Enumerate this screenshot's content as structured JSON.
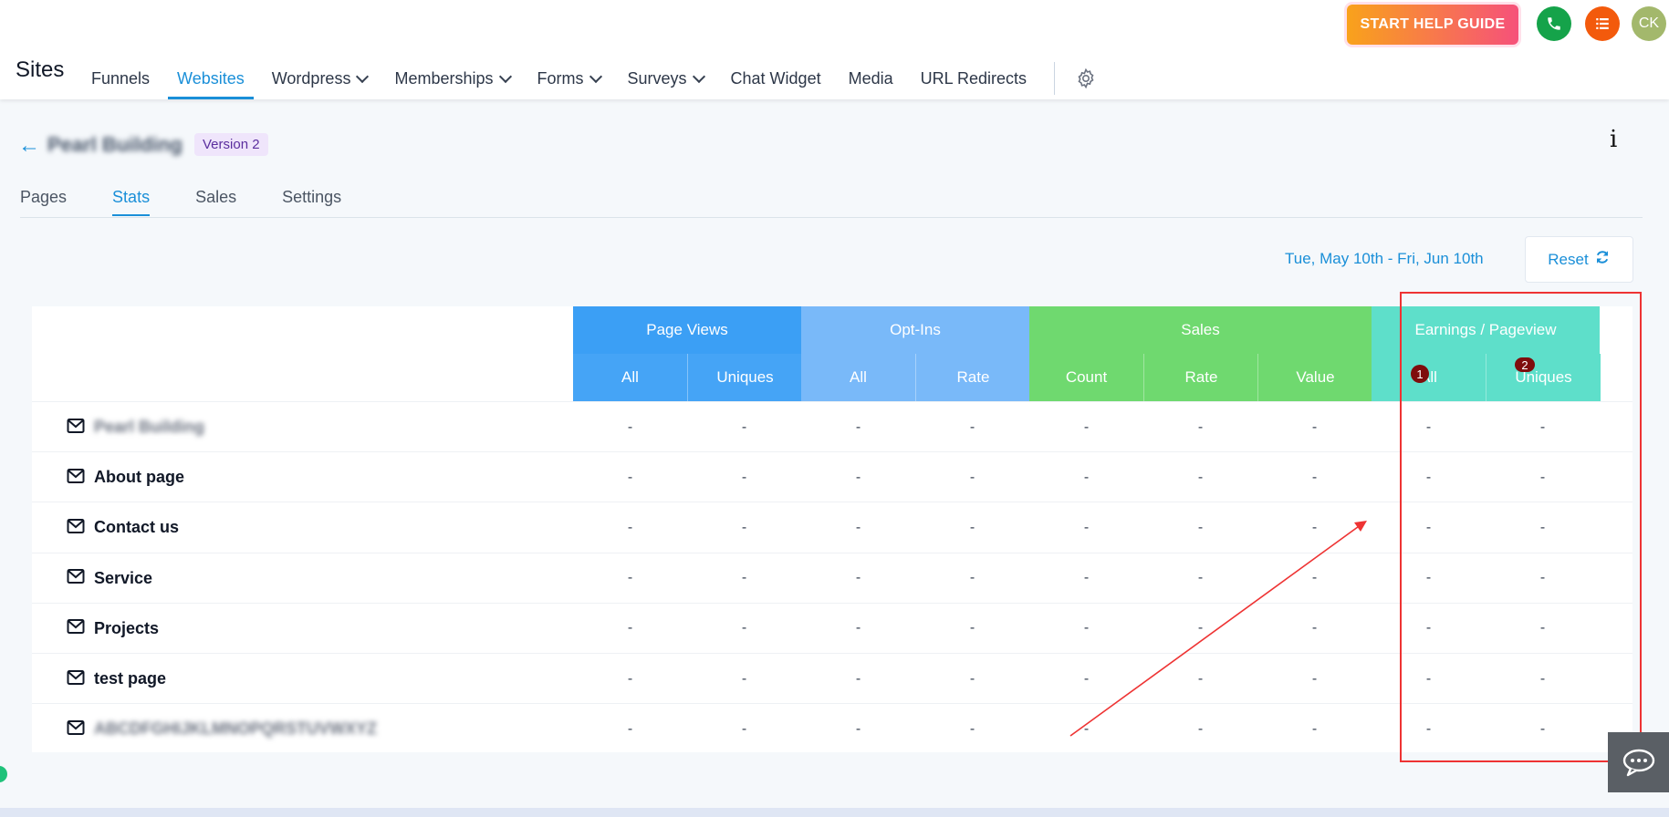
{
  "topbar": {
    "brand": "Sites",
    "nav": [
      {
        "label": "Funnels",
        "dropdown": false,
        "active": false
      },
      {
        "label": "Websites",
        "dropdown": false,
        "active": true
      },
      {
        "label": "Wordpress",
        "dropdown": true,
        "active": false
      },
      {
        "label": "Memberships",
        "dropdown": true,
        "active": false
      },
      {
        "label": "Forms",
        "dropdown": true,
        "active": false
      },
      {
        "label": "Surveys",
        "dropdown": true,
        "active": false
      },
      {
        "label": "Chat Widget",
        "dropdown": false,
        "active": false
      },
      {
        "label": "Media",
        "dropdown": false,
        "active": false
      },
      {
        "label": "URL Redirects",
        "dropdown": false,
        "active": false
      }
    ],
    "help_button": "START HELP GUIDE",
    "avatar_initials": "CK"
  },
  "header": {
    "site_name": "Pearl Building",
    "version": "Version 2",
    "info_symbol": "i"
  },
  "subtabs": [
    {
      "label": "Pages",
      "active": false
    },
    {
      "label": "Stats",
      "active": true
    },
    {
      "label": "Sales",
      "active": false
    },
    {
      "label": "Settings",
      "active": false
    }
  ],
  "toolbar": {
    "date_range": "Tue, May 10th - Fri, Jun 10th",
    "reset_label": "Reset"
  },
  "table": {
    "groups": [
      "Page Views",
      "Opt-Ins",
      "Sales",
      "Earnings / Pageview"
    ],
    "columns": [
      "All",
      "Uniques",
      "All",
      "Rate",
      "Count",
      "Rate",
      "Value",
      "All",
      "Uniques"
    ],
    "rows": [
      {
        "name": "Pearl Building",
        "blurred": true,
        "values": [
          "-",
          "-",
          "-",
          "-",
          "-",
          "-",
          "-",
          "-",
          "-"
        ]
      },
      {
        "name": "About page",
        "blurred": false,
        "values": [
          "-",
          "-",
          "-",
          "-",
          "-",
          "-",
          "-",
          "-",
          "-"
        ]
      },
      {
        "name": "Contact us",
        "blurred": false,
        "values": [
          "-",
          "-",
          "-",
          "-",
          "-",
          "-",
          "-",
          "-",
          "-"
        ]
      },
      {
        "name": "Service",
        "blurred": false,
        "values": [
          "-",
          "-",
          "-",
          "-",
          "-",
          "-",
          "-",
          "-",
          "-"
        ]
      },
      {
        "name": "Projects",
        "blurred": false,
        "values": [
          "-",
          "-",
          "-",
          "-",
          "-",
          "-",
          "-",
          "-",
          "-"
        ]
      },
      {
        "name": "test page",
        "blurred": false,
        "values": [
          "-",
          "-",
          "-",
          "-",
          "-",
          "-",
          "-",
          "-",
          "-"
        ]
      },
      {
        "name": "ABCDFGHIJKLMNOPQRSTUVWXYZ",
        "blurred": true,
        "values": [
          "-",
          "-",
          "-",
          "-",
          "-",
          "-",
          "-",
          "-",
          "-"
        ]
      }
    ]
  },
  "annotations": {
    "marker1": "1",
    "marker2": "2"
  },
  "colors": {
    "accent": "#1a8fd8",
    "page_views": "#3b9ff5",
    "opt_ins": "#79b9f9",
    "sales": "#6fd96f",
    "earnings": "#5edfca",
    "annotation": "#e33333"
  },
  "icons": [
    "back-arrow-icon",
    "gear-icon",
    "phone-icon",
    "list-icon",
    "info-icon",
    "refresh-icon",
    "mail-icon",
    "chat-icon",
    "chevron-down-icon"
  ]
}
